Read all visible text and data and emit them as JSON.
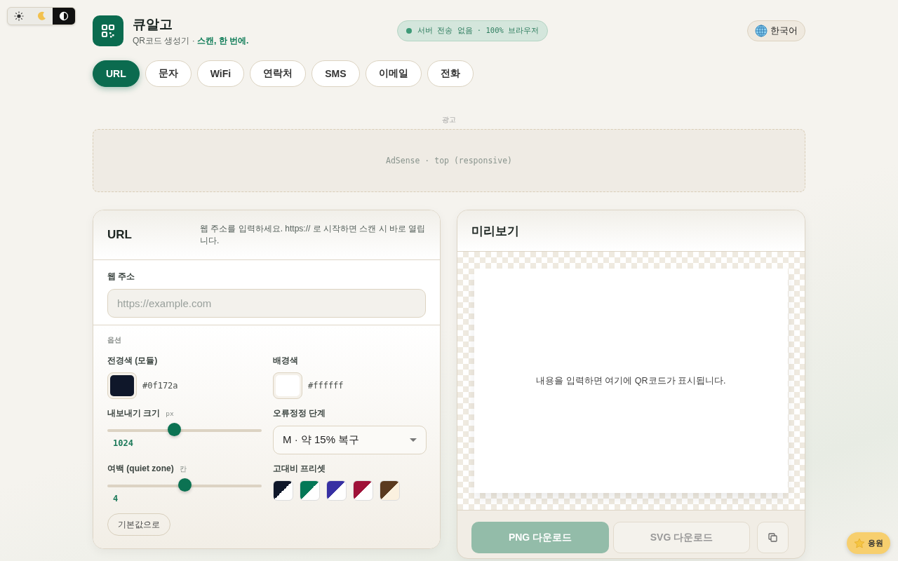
{
  "theme_toggle": [
    {
      "kind": "light",
      "selected": false
    },
    {
      "kind": "dark",
      "selected": false
    },
    {
      "kind": "contrast",
      "selected": true
    }
  ],
  "brand": {
    "name": "큐알고",
    "tagline": "QR코드 생성기 · ",
    "tagline_accent": "스캔, 한 번에."
  },
  "privacy_badge": "서버 전송 없음 · 100% 브라우저",
  "language_button": "한국어",
  "tabs": [
    {
      "label": "URL",
      "selected": true
    },
    {
      "label": "문자",
      "selected": false
    },
    {
      "label": "WiFi",
      "selected": false
    },
    {
      "label": "연락처",
      "selected": false
    },
    {
      "label": "SMS",
      "selected": false
    },
    {
      "label": "이메일",
      "selected": false
    },
    {
      "label": "전화",
      "selected": false
    }
  ],
  "ad": {
    "label": "광고",
    "slot": "AdSense · top (responsive)"
  },
  "form": {
    "title": "URL",
    "hint": "웹 주소를 입력하세요. https:// 로 시작하면 스캔 시 바로 열립니다.",
    "field_label": "웹 주소",
    "placeholder": "https://example.com"
  },
  "options": {
    "heading": "옵션",
    "foreground": {
      "label": "전경색 (모듈)",
      "value": "#0f172a"
    },
    "background": {
      "label": "배경색",
      "value": "#ffffff"
    },
    "export_size": {
      "label": "내보내기 크기",
      "unit": "px",
      "level": 0.43,
      "reading": "1024"
    },
    "error_correction": {
      "label": "오류정정 단계",
      "value": "M · 약 15% 복구"
    },
    "quiet_zone": {
      "label": "여백 (quiet zone)",
      "unit": "칸",
      "level": 0.5,
      "reading": "4"
    },
    "presets_label": "고대비 프리셋",
    "presets": [
      {
        "color": "#0f172a",
        "kind": "white"
      },
      {
        "color": "#047857",
        "kind": "white"
      },
      {
        "color": "#3730a3",
        "kind": "white"
      },
      {
        "color": "#9f1239",
        "kind": "white"
      },
      {
        "color": "#5b3a1f",
        "kind": "cream"
      }
    ],
    "reset_button": "기본값으로"
  },
  "preview": {
    "title": "미리보기",
    "empty_message": "내용을 입력하면 여기에 QR코드가 표시됩니다.",
    "png_button": "PNG 다운로드",
    "svg_button": "SVG 다운로드",
    "png_disabled": true,
    "svg_disabled": true
  },
  "support_button": "응원"
}
